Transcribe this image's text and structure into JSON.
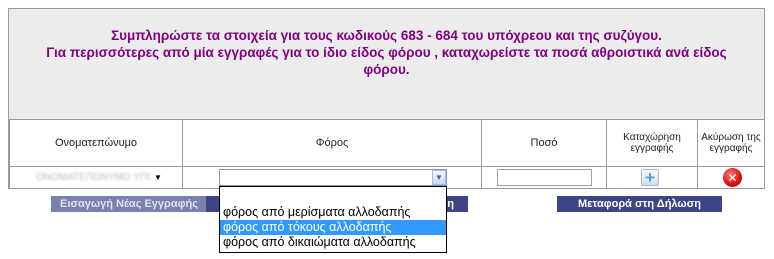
{
  "instructions": {
    "line1": "Συμπληρώστε τα στοιχεία για τους κωδικούς 683 - 684 του υπόχρεου και της συζύγου.",
    "line2": "Για περισσότερες από μία εγγραφές για το ίδιο είδος φόρου , καταχωρείστε τα ποσά αθροιστικά ανά είδος",
    "line3": "φόρου."
  },
  "table": {
    "headers": {
      "name": "Ονοματεπώνυμο",
      "tax": "Φόρος",
      "amount": "Ποσό",
      "register": "Καταχώρηση εγγραφής",
      "cancel": "Ακύρωση της εγγραφής"
    },
    "row": {
      "name_value": "ΟΝΟΜΑΤΕΠΩΝΥΜΟ ΥΠΟΧΡΕΟΥ",
      "tax_value": "",
      "amount_value": ""
    }
  },
  "buttons": {
    "new_entry": "Εισαγωγή Νέας Εγγραφής",
    "mid_partial": "η",
    "transfer": "Μεταφορά στη Δήλωση"
  },
  "dropdown": {
    "options": [
      "φόρος από μερίσματα αλλοδαπής",
      "φόρος από τόκους αλλοδαπής",
      "φόρος από δικαιώματα αλλοδαπής"
    ],
    "highlighted_index": 1
  },
  "icons": {
    "arrow": "▼",
    "plus": "+",
    "cancel": "✕"
  },
  "colors": {
    "instruction_text": "#800080",
    "button_dark": "#3d4584",
    "highlight": "#3399ff",
    "cancel_red": "#d01010"
  }
}
